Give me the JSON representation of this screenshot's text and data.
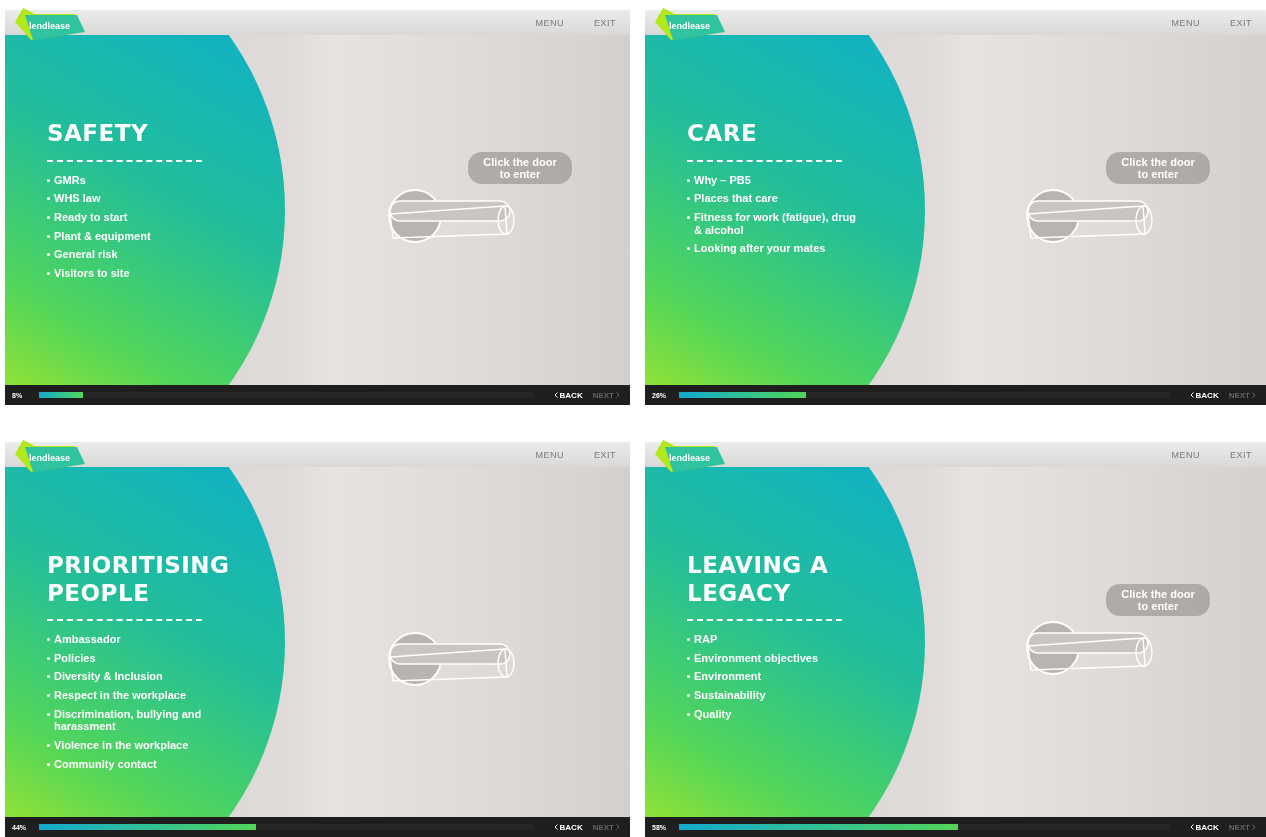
{
  "screens": [
    {
      "logo": "lendlease",
      "menu": "MENU",
      "exit": "EXIT",
      "title": "SAFETY",
      "items": [
        "GMRs",
        "WHS law",
        "Ready to start",
        "Plant & equipment",
        "General risk",
        "Visitors to site"
      ],
      "hint": "Click the door to enter",
      "progress_label": "8%",
      "level": 0.09,
      "back": "BACK",
      "next": {
        "label": "NEXT",
        "disabled": true
      }
    },
    {
      "logo": "lendlease",
      "menu": "MENU",
      "exit": "EXIT",
      "title": "CARE",
      "items": [
        "Why – PB5",
        "Places that care",
        "Fitness for work (fatigue), drug & alcohol",
        "Looking after your mates"
      ],
      "hint": "Click the door to enter",
      "progress_label": "26%",
      "level": 0.26,
      "back": "BACK",
      "next": {
        "label": "NEXT",
        "disabled": true
      }
    },
    {
      "logo": "lendlease",
      "menu": "MENU",
      "exit": "EXIT",
      "title": "PRIORITISING PEOPLE",
      "items": [
        "Ambassador",
        "Policies",
        "Diversity & Inclusion",
        "Respect in the workplace",
        "Discrimination, bullying and harassment",
        "Violence in the workplace",
        "Community contact"
      ],
      "progress_label": "44%",
      "level": 0.44,
      "back": "BACK",
      "next": {
        "label": "NEXT",
        "disabled": true
      }
    },
    {
      "logo": "lendlease",
      "menu": "MENU",
      "exit": "EXIT",
      "title": "LEAVING A LEGACY",
      "items": [
        "RAP",
        "Environment objectives",
        "Environment",
        "Sustainability",
        "Quality"
      ],
      "hint": "Click the door to enter",
      "progress_label": "58%",
      "level": 0.57,
      "back": "BACK",
      "next": {
        "label": "NEXT",
        "disabled": true
      }
    }
  ]
}
